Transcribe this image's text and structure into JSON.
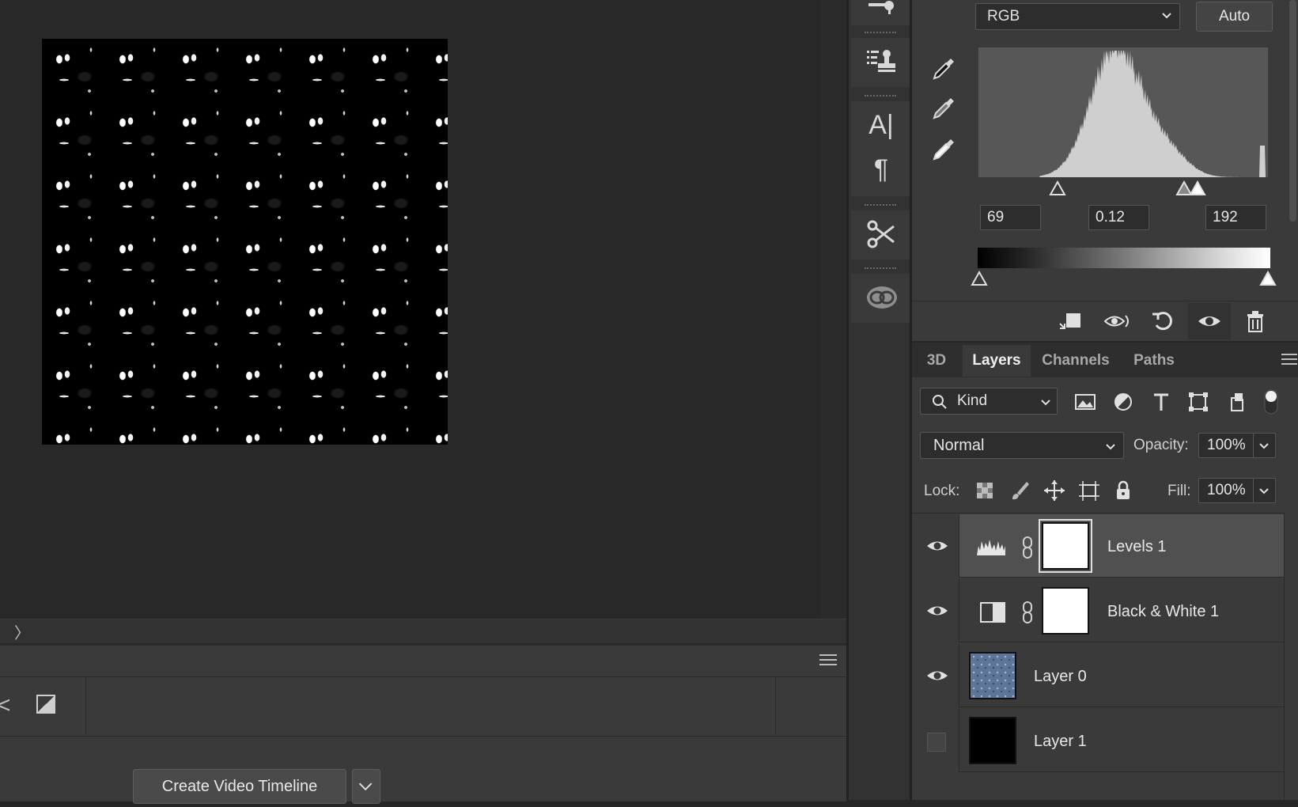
{
  "levels": {
    "channel": "RGB",
    "auto_label": "Auto",
    "input_black": "69",
    "input_mid": "0.12",
    "input_white": "192"
  },
  "tabs": [
    {
      "label": "3D"
    },
    {
      "label": "Layers"
    },
    {
      "label": "Channels"
    },
    {
      "label": "Paths"
    }
  ],
  "layers_panel": {
    "kind_filter": "Kind",
    "blend_mode": "Normal",
    "opacity_label": "Opacity:",
    "opacity_value": "100%",
    "lock_label": "Lock:",
    "fill_label": "Fill:",
    "fill_value": "100%"
  },
  "layers": [
    {
      "name": "Levels 1",
      "visible": true,
      "selected": true,
      "type": "levels-adjustment"
    },
    {
      "name": "Black & White 1",
      "visible": true,
      "selected": false,
      "type": "black-white-adjustment"
    },
    {
      "name": "Layer 0",
      "visible": true,
      "selected": false,
      "type": "pixel"
    },
    {
      "name": "Layer 1",
      "visible": false,
      "selected": false,
      "type": "pixel"
    }
  ],
  "timeline": {
    "create_button": "Create Video Timeline"
  },
  "colors": {
    "panel_bg": "#3a3a3a",
    "canvas_bg": "#282828",
    "selected_row": "#505050",
    "layer0_thumb": "#5d7598"
  }
}
